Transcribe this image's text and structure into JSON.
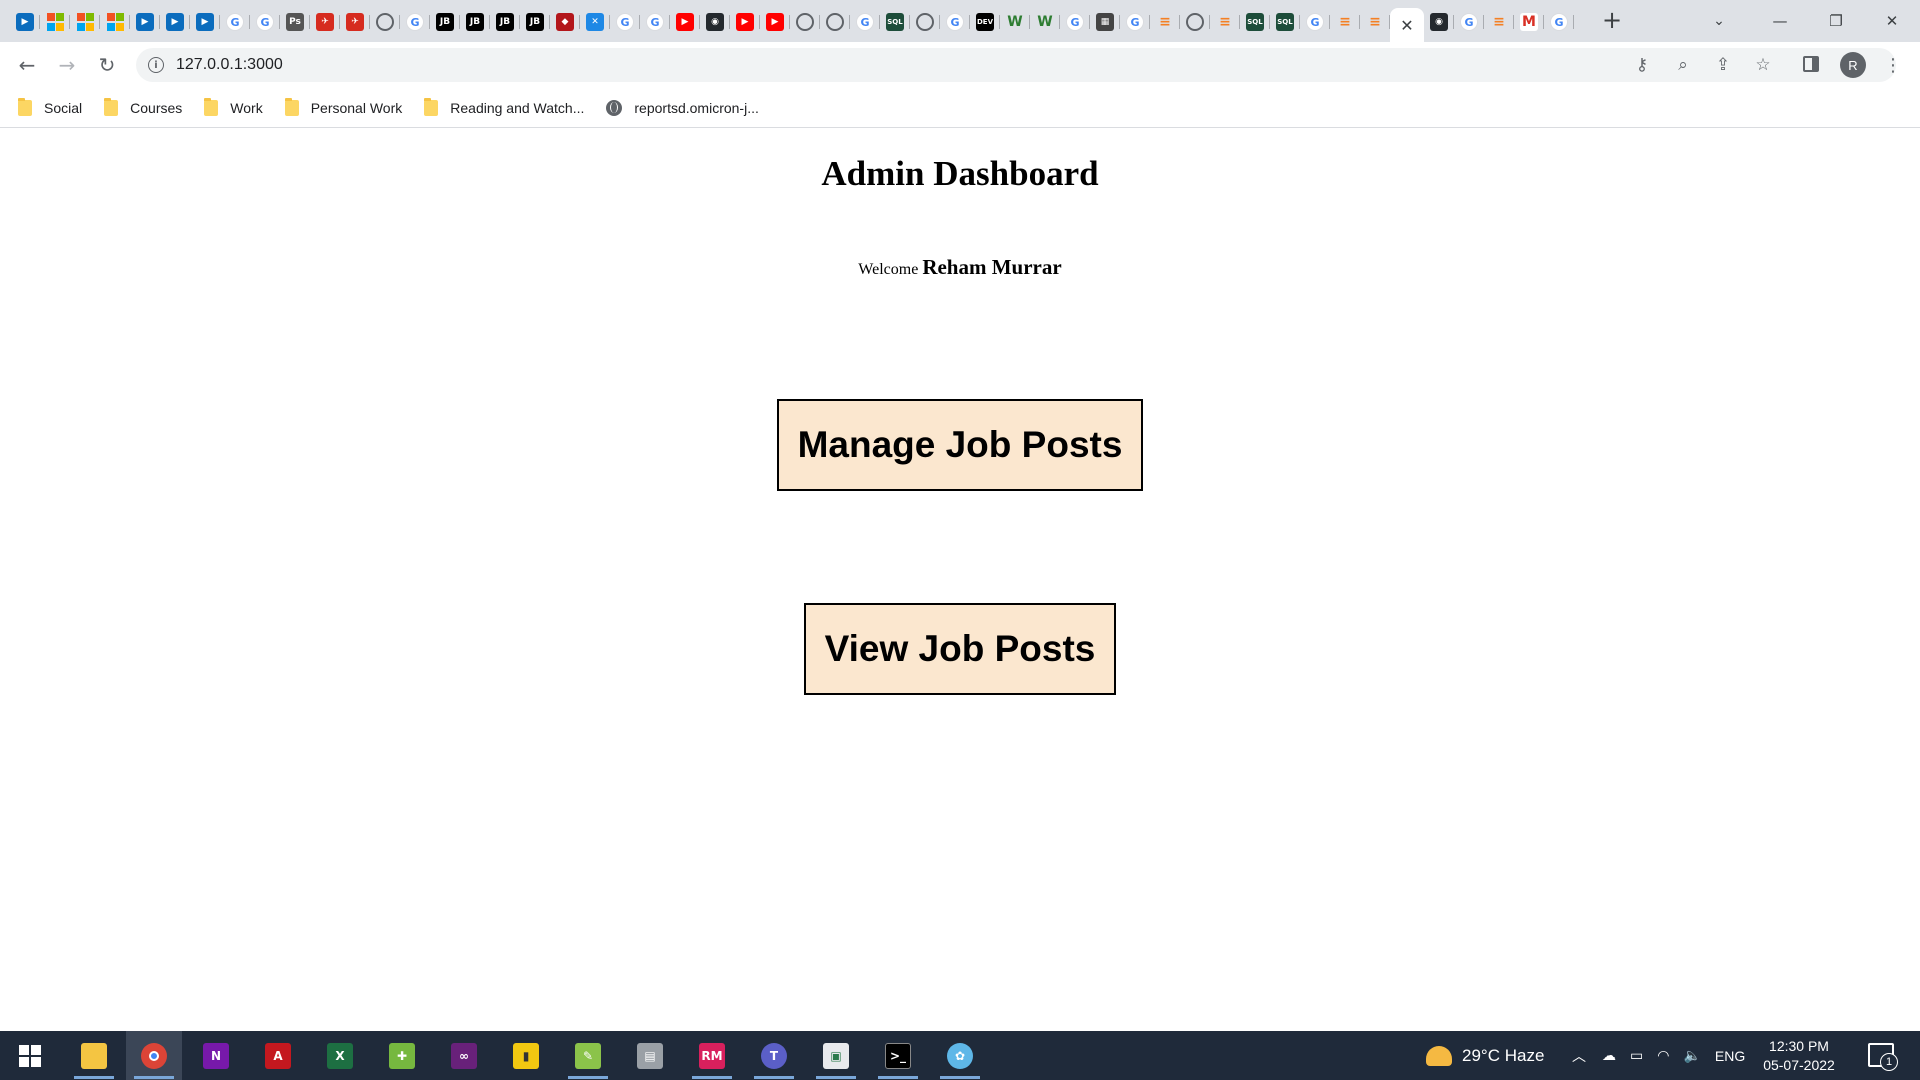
{
  "browser": {
    "tab_favicons": [
      {
        "icon": "media-icon",
        "glyph": "▶",
        "color": "#0b6cbd"
      },
      {
        "icon": "microsoft-icon",
        "glyph": "",
        "color": "#f25022"
      },
      {
        "icon": "microsoft-icon",
        "glyph": "",
        "color": "#f25022"
      },
      {
        "icon": "microsoft-icon",
        "glyph": "",
        "color": "#f25022"
      },
      {
        "icon": "media-icon",
        "glyph": "▶",
        "color": "#0b6cbd"
      },
      {
        "icon": "media-icon",
        "glyph": "▶",
        "color": "#0b6cbd"
      },
      {
        "icon": "media-icon",
        "glyph": "▶",
        "color": "#0b6cbd"
      },
      {
        "icon": "google-icon",
        "glyph": "G",
        "color": "#4285f4"
      },
      {
        "icon": "google-icon",
        "glyph": "G",
        "color": "#4285f4"
      },
      {
        "icon": "ps-icon",
        "glyph": "Ps",
        "color": "#555555"
      },
      {
        "icon": "fast-icon",
        "glyph": "✈",
        "color": "#d62b1f"
      },
      {
        "icon": "fast-icon",
        "glyph": "✈",
        "color": "#d62b1f"
      },
      {
        "icon": "globe-icon",
        "glyph": "●",
        "color": "#5f6368"
      },
      {
        "icon": "google-icon",
        "glyph": "G",
        "color": "#4285f4"
      },
      {
        "icon": "jetbrains-icon",
        "glyph": "JB",
        "color": "#000000"
      },
      {
        "icon": "jetbrains-icon",
        "glyph": "JB",
        "color": "#000000"
      },
      {
        "icon": "jetbrains-icon",
        "glyph": "JB",
        "color": "#000000"
      },
      {
        "icon": "jetbrains-icon",
        "glyph": "JB",
        "color": "#000000"
      },
      {
        "icon": "red-app-icon",
        "glyph": "◆",
        "color": "#b3161b"
      },
      {
        "icon": "vscode-icon",
        "glyph": "✕",
        "color": "#1e88e5"
      },
      {
        "icon": "google-icon",
        "glyph": "G",
        "color": "#4285f4"
      },
      {
        "icon": "google-icon",
        "glyph": "G",
        "color": "#4285f4"
      },
      {
        "icon": "youtube-icon",
        "glyph": "▶",
        "color": "#ff0000"
      },
      {
        "icon": "github-icon",
        "glyph": "◉",
        "color": "#24292e"
      },
      {
        "icon": "youtube-icon",
        "glyph": "▶",
        "color": "#ff0000"
      },
      {
        "icon": "youtube-icon",
        "glyph": "▶",
        "color": "#ff0000"
      },
      {
        "icon": "globe-icon",
        "glyph": "●",
        "color": "#5f6368"
      },
      {
        "icon": "globe-icon",
        "glyph": "●",
        "color": "#5f6368"
      },
      {
        "icon": "google-icon",
        "glyph": "G",
        "color": "#4285f4"
      },
      {
        "icon": "sql-icon",
        "glyph": "SQL",
        "color": "#1d4d3a"
      },
      {
        "icon": "globe-icon",
        "glyph": "●",
        "color": "#5f6368"
      },
      {
        "icon": "google-icon",
        "glyph": "G",
        "color": "#4285f4"
      },
      {
        "icon": "dev-icon",
        "glyph": "DEV",
        "color": "#000000"
      },
      {
        "icon": "w-icon",
        "glyph": "W",
        "color": "#2e7d32"
      },
      {
        "icon": "w-icon",
        "glyph": "W",
        "color": "#2e7d32"
      },
      {
        "icon": "google-icon",
        "glyph": "G",
        "color": "#4285f4"
      },
      {
        "icon": "dark-app-icon",
        "glyph": "▦",
        "color": "#444444"
      },
      {
        "icon": "google-icon",
        "glyph": "G",
        "color": "#4285f4"
      },
      {
        "icon": "stackoverflow-icon",
        "glyph": "≡",
        "color": "#f48024"
      },
      {
        "icon": "globe-icon",
        "glyph": "●",
        "color": "#5f6368"
      },
      {
        "icon": "stackoverflow-icon",
        "glyph": "≡",
        "color": "#f48024"
      },
      {
        "icon": "sql-icon",
        "glyph": "SQL",
        "color": "#1d4d3a"
      },
      {
        "icon": "sql-icon",
        "glyph": "SQL",
        "color": "#1d4d3a"
      },
      {
        "icon": "google-icon",
        "glyph": "G",
        "color": "#4285f4"
      },
      {
        "icon": "stackoverflow-icon",
        "glyph": "≡",
        "color": "#f48024"
      },
      {
        "icon": "stackoverflow-icon",
        "glyph": "≡",
        "color": "#f48024"
      }
    ],
    "tab_favicons_after": [
      {
        "icon": "github-icon",
        "glyph": "◉",
        "color": "#24292e"
      },
      {
        "icon": "google-icon",
        "glyph": "G",
        "color": "#4285f4"
      },
      {
        "icon": "stackoverflow-icon",
        "glyph": "≡",
        "color": "#f48024"
      },
      {
        "icon": "gmail-icon",
        "glyph": "M",
        "color": "#d93025"
      },
      {
        "icon": "translate-icon",
        "glyph": "G",
        "color": "#4285f4"
      }
    ],
    "active_tab_close": "✕",
    "new_tab_glyph": "+",
    "url": "127.0.0.1:3000",
    "profile_initial": "R"
  },
  "bookmarks": [
    {
      "type": "folder",
      "label": "Social"
    },
    {
      "type": "folder",
      "label": "Courses"
    },
    {
      "type": "folder",
      "label": "Work"
    },
    {
      "type": "folder",
      "label": "Personal Work"
    },
    {
      "type": "folder",
      "label": "Reading and Watch..."
    },
    {
      "type": "site",
      "label": "reportsd.omicron-j..."
    }
  ],
  "page": {
    "title": "Admin Dashboard",
    "welcome_label": "Welcome",
    "user_name": "Reham Murrar",
    "manage_button": "Manage Job Posts",
    "view_button": "View Job Posts",
    "button_bg": "#fbe7cf"
  },
  "taskbar": {
    "weather": "29°C  Haze",
    "language": "ENG",
    "time": "12:30 PM",
    "date": "05-07-2022",
    "notification_count": "1"
  }
}
